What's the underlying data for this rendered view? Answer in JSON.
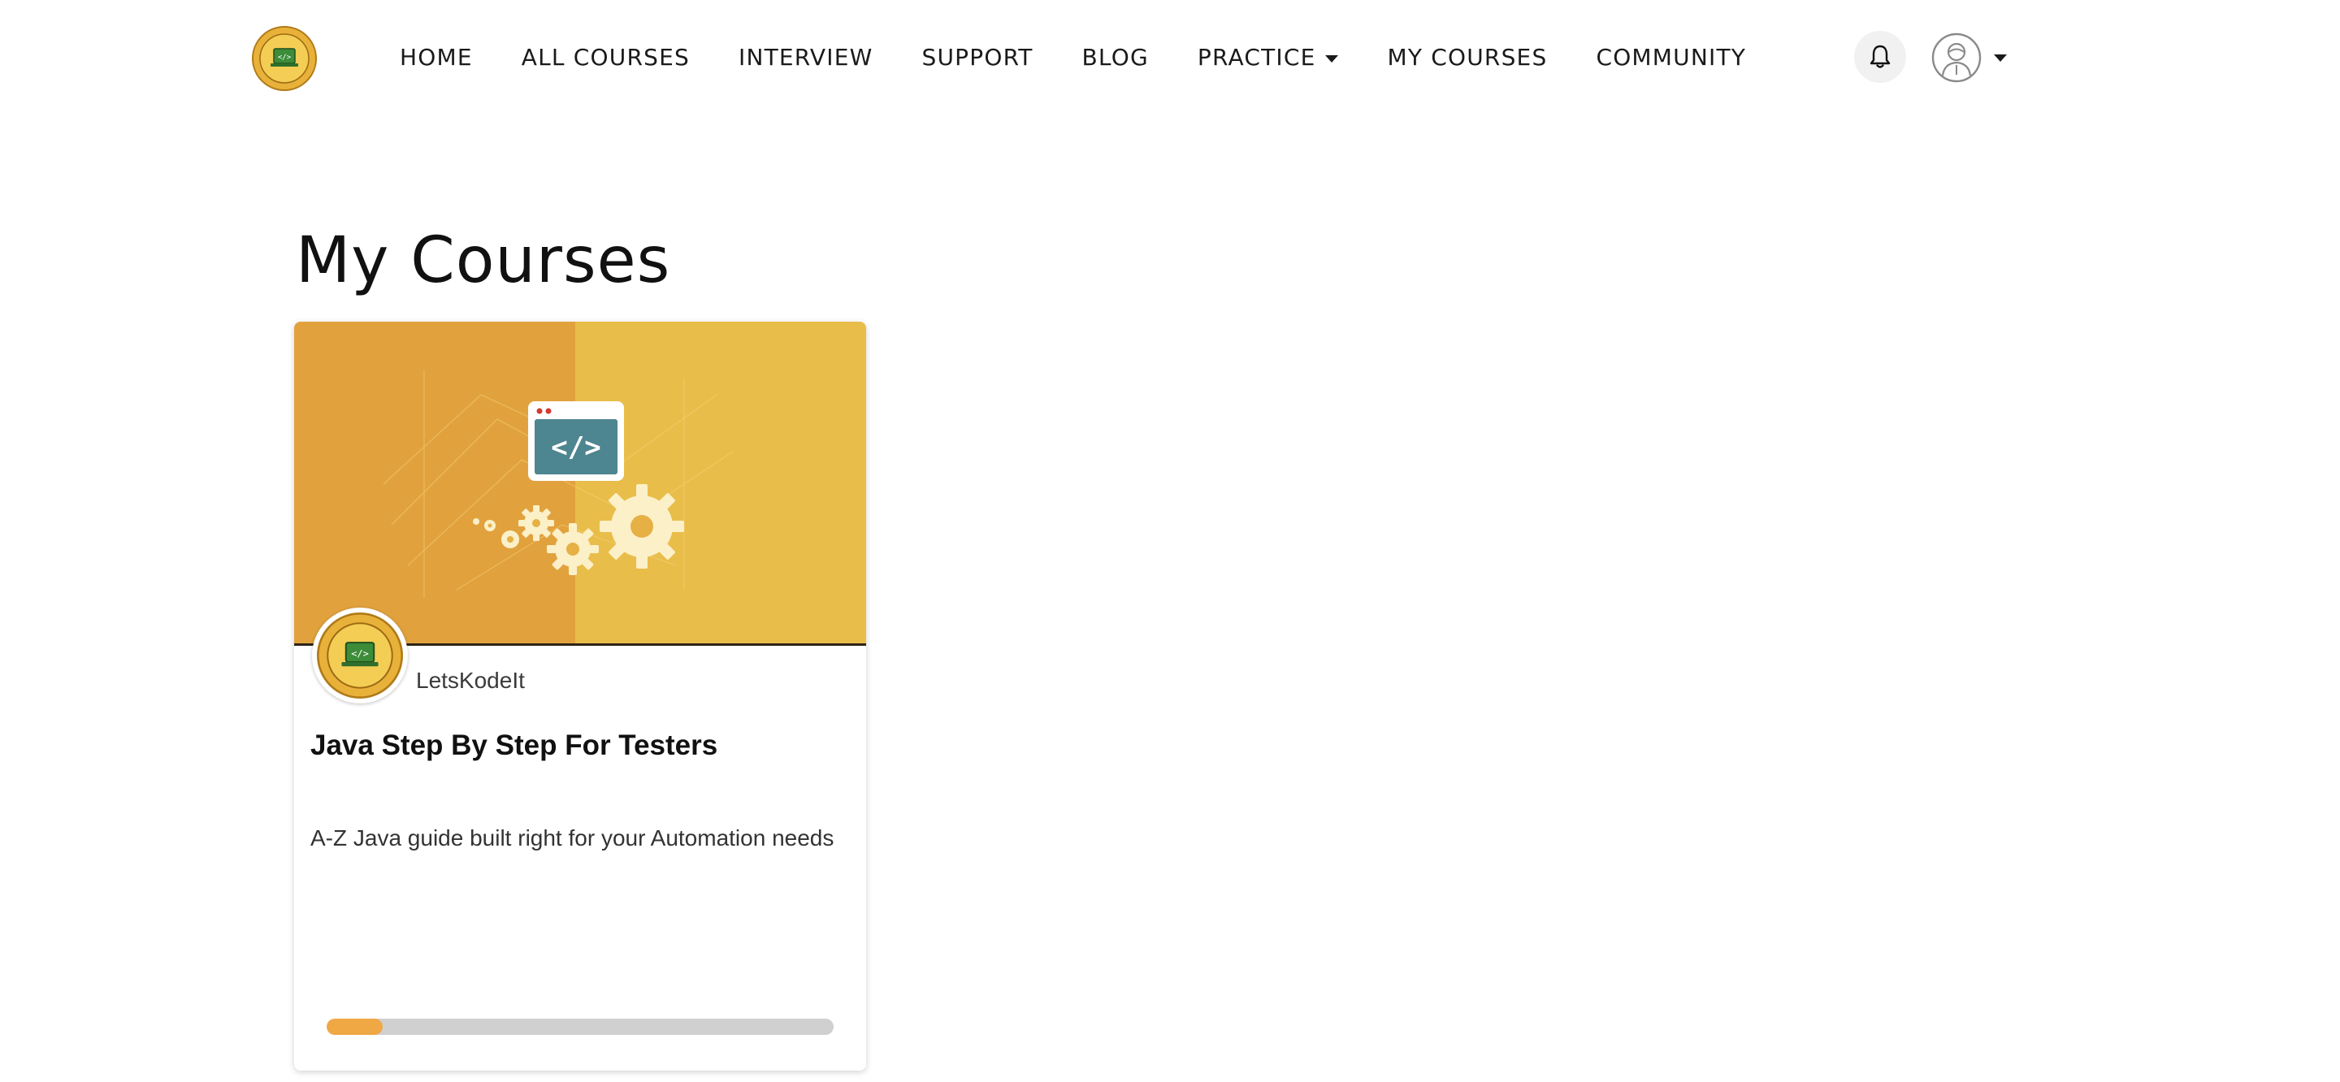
{
  "brand": {
    "logo_icon": "letskodeit-logo-icon"
  },
  "nav": {
    "items": [
      {
        "label": "HOME"
      },
      {
        "label": "ALL COURSES"
      },
      {
        "label": "INTERVIEW"
      },
      {
        "label": "SUPPORT"
      },
      {
        "label": "BLOG"
      },
      {
        "label": "PRACTICE",
        "dropdown": true
      },
      {
        "label": "MY COURSES"
      },
      {
        "label": "COMMUNITY"
      }
    ],
    "notifications_icon": "bell-icon",
    "user_icon": "user-avatar-icon"
  },
  "main": {
    "title": "My Courses",
    "courses": [
      {
        "author": "LetsKodeIt",
        "title": "Java Step By Step For Testers",
        "description": "A-Z Java guide built right for your Automation needs",
        "progress_fraction": 0.11,
        "image_icon": "code-window-gears-icon"
      }
    ]
  },
  "colors": {
    "card_image_left": "#e1a23e",
    "card_image_right": "#e9bd49",
    "progress_fill": "#f0a845",
    "progress_track": "#d0d0d0"
  }
}
